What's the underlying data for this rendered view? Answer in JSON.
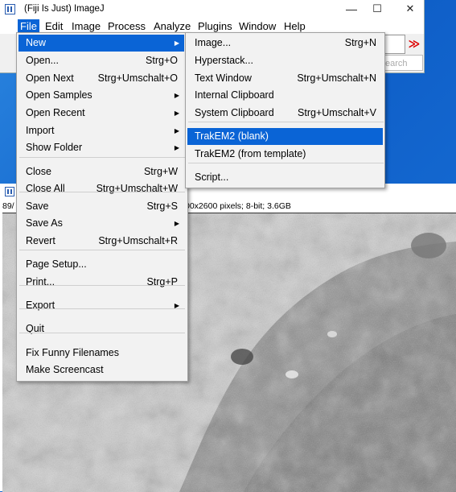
{
  "window": {
    "title": "(Fiji Is Just) ImageJ",
    "minimize": "—",
    "maximize": "☐",
    "close": "✕"
  },
  "menubar": [
    "File",
    "Edit",
    "Image",
    "Process",
    "Analyze",
    "Plugins",
    "Window",
    "Help"
  ],
  "toolbar": {
    "more_tools": "≫",
    "search_placeholder": "earch"
  },
  "image_window": {
    "info_left": "89/",
    "info_right": "00x2600 pixels; 8-bit; 3.6GB"
  },
  "file_menu": [
    {
      "label": "New",
      "shortcut": "",
      "submenu": true
    },
    {
      "label": "Open...",
      "shortcut": "Strg+O",
      "submenu": false
    },
    {
      "label": "Open Next",
      "shortcut": "Strg+Umschalt+O",
      "submenu": false
    },
    {
      "label": "Open Samples",
      "shortcut": "",
      "submenu": true
    },
    {
      "label": "Open Recent",
      "shortcut": "",
      "submenu": true
    },
    {
      "label": "Import",
      "shortcut": "",
      "submenu": true
    },
    {
      "label": "Show Folder",
      "shortcut": "",
      "submenu": true
    },
    {
      "label": "Close",
      "shortcut": "Strg+W",
      "submenu": false
    },
    {
      "label": "Close All",
      "shortcut": "Strg+Umschalt+W",
      "submenu": false
    },
    {
      "label": "Save",
      "shortcut": "Strg+S",
      "submenu": false
    },
    {
      "label": "Save As",
      "shortcut": "",
      "submenu": true
    },
    {
      "label": "Revert",
      "shortcut": "Strg+Umschalt+R",
      "submenu": false
    },
    {
      "label": "Page Setup...",
      "shortcut": "",
      "submenu": false
    },
    {
      "label": "Print...",
      "shortcut": "Strg+P",
      "submenu": false
    },
    {
      "label": "Export",
      "shortcut": "",
      "submenu": true
    },
    {
      "label": "Quit",
      "shortcut": "",
      "submenu": false
    },
    {
      "label": "Fix Funny Filenames",
      "shortcut": "",
      "submenu": false
    },
    {
      "label": "Make Screencast",
      "shortcut": "",
      "submenu": false
    }
  ],
  "new_submenu": [
    {
      "label": "Image...",
      "shortcut": "Strg+N"
    },
    {
      "label": "Hyperstack...",
      "shortcut": ""
    },
    {
      "label": "Text Window",
      "shortcut": "Strg+Umschalt+N"
    },
    {
      "label": "Internal Clipboard",
      "shortcut": ""
    },
    {
      "label": "System Clipboard",
      "shortcut": "Strg+Umschalt+V"
    },
    {
      "label": "TrakEM2 (blank)",
      "shortcut": ""
    },
    {
      "label": "TrakEM2 (from template)",
      "shortcut": ""
    },
    {
      "label": "Script...",
      "shortcut": ""
    }
  ],
  "colors": {
    "highlight": "#0a64d6",
    "menu_bg": "#f2f2f2",
    "desktop": "#1a6fd6"
  }
}
